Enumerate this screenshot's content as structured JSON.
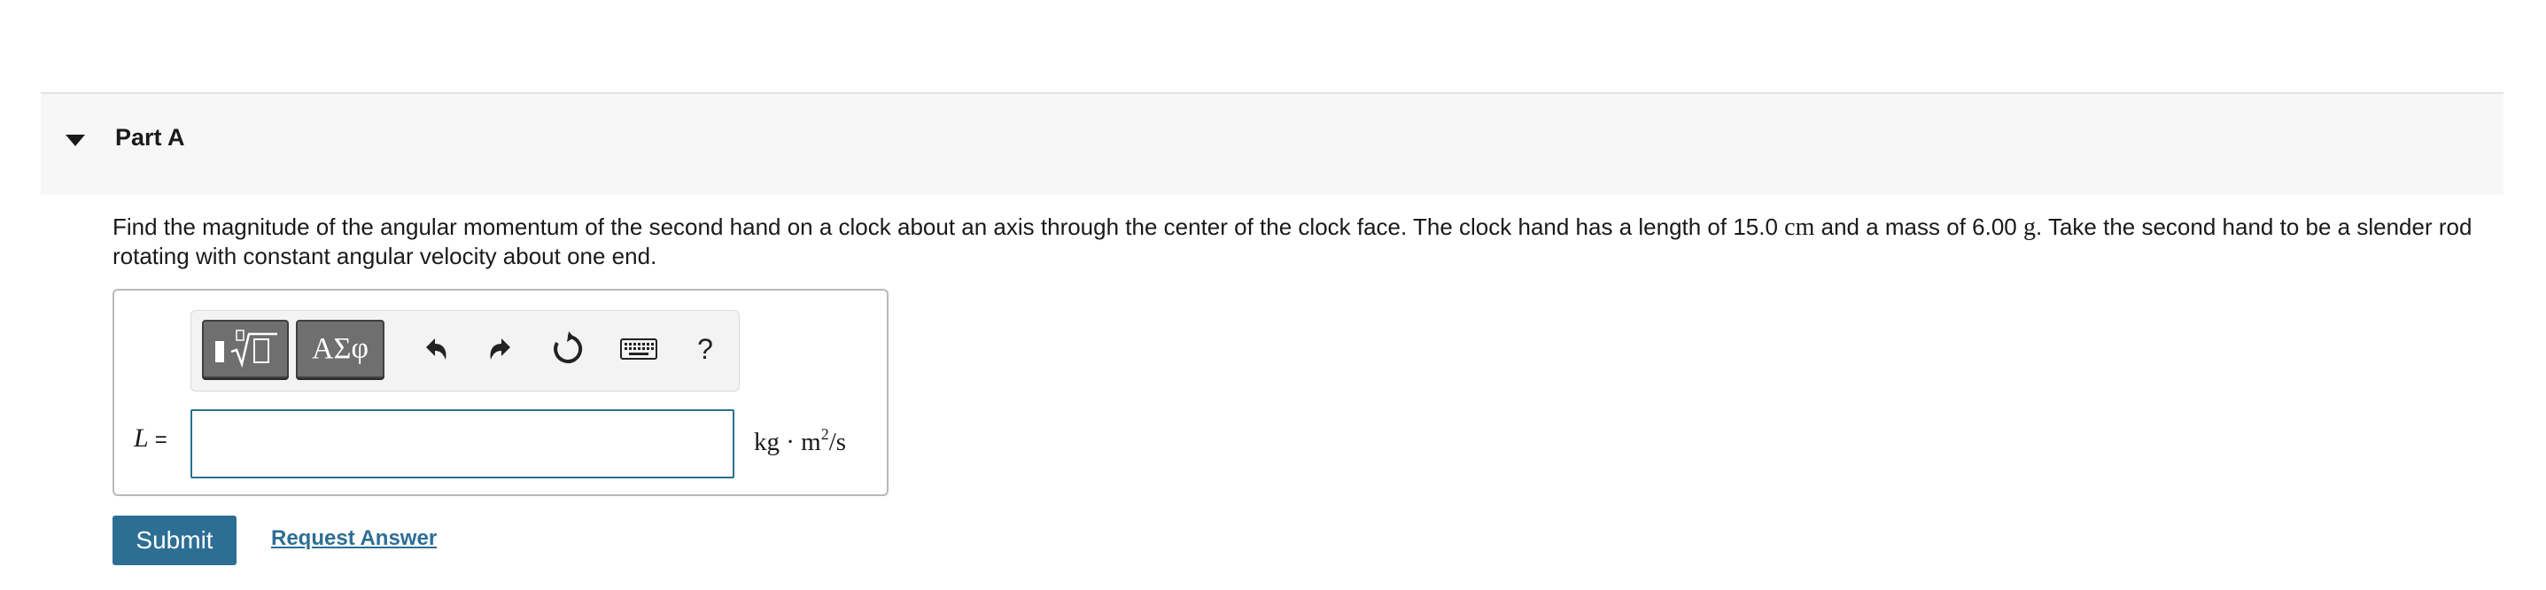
{
  "part": {
    "title": "Part A"
  },
  "question": {
    "line1_a": "Find the magnitude of the angular momentum of the second hand on a clock about an axis through the center of the clock face. The clock hand has a length of 15.0 ",
    "length_unit": "cm",
    "line1_b": " and a mass of 6.00 ",
    "mass_unit": "g",
    "line1_c": ". Take the second hand to be a slender rod rotating with constant angular velocity about one end."
  },
  "toolbar": {
    "templates_icon": "templates-sqrt-icon",
    "symbols_label": "ΑΣφ",
    "undo_icon": "undo-icon",
    "redo_icon": "redo-icon",
    "reset_icon": "reset-icon",
    "keyboard_icon": "keyboard-icon",
    "help_label": "?"
  },
  "answer": {
    "variable": "L",
    "equals": "=",
    "value": "",
    "unit_kg": "kg",
    "unit_dot": "·",
    "unit_m": "m",
    "unit_exp": "2",
    "unit_rest": "/s"
  },
  "actions": {
    "submit_label": "Submit",
    "request_label": "Request Answer"
  },
  "colors": {
    "accent": "#2d6e94",
    "header_bg": "#f7f7f7",
    "input_border": "#2b6f91"
  }
}
